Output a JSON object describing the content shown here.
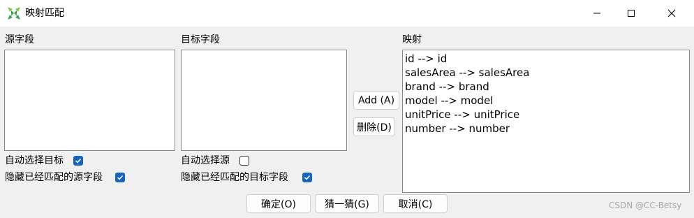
{
  "window": {
    "title": "映射匹配",
    "accent_color": "#1565c0"
  },
  "titlebar_controls": {
    "minimize_icon": "minimize-icon",
    "maximize_icon": "maximize-icon",
    "close_icon": "close-icon"
  },
  "source_fields": {
    "label": "源字段",
    "items": []
  },
  "target_fields": {
    "label": "目标字段",
    "items": []
  },
  "mapping": {
    "label": "映射",
    "items": [
      "id --> id",
      "salesArea --> salesArea",
      "brand --> brand",
      "model --> model",
      "unitPrice --> unitPrice",
      "number --> number"
    ]
  },
  "options": {
    "auto_select_target": {
      "label": "自动选择目标",
      "checked": true
    },
    "hide_matched_source": {
      "label": "隐藏已经匹配的源字段",
      "checked": true
    },
    "auto_select_source": {
      "label": "自动选择源",
      "checked": false
    },
    "hide_matched_target": {
      "label": "隐藏已经匹配的目标字段",
      "checked": true
    }
  },
  "buttons": {
    "add": "Add (A)",
    "delete": "删除(D)",
    "ok": "确定(O)",
    "guess": "猜一猜(G)",
    "cancel": "取消(C)"
  },
  "watermark": "CSDN @CC-Betsy"
}
